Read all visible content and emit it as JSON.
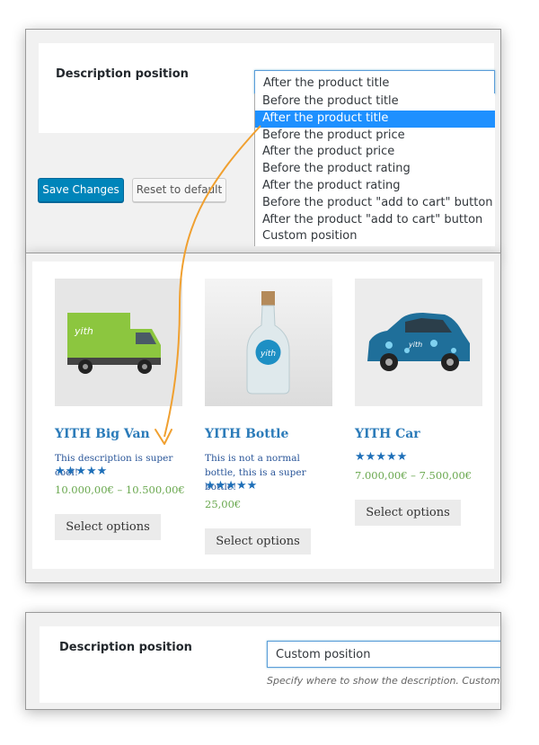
{
  "top_panel": {
    "label": "Description position",
    "select_value": "After the product title",
    "options": [
      "Before the product title",
      "After the product title",
      "Before the product price",
      "After the product price",
      "Before the product rating",
      "After the product rating",
      "Before the product \"add to cart\" button",
      "After the product \"add to cart\" button",
      "Custom position"
    ],
    "selected_index": 1,
    "save_label": "Save Changes",
    "reset_label": "Reset to default"
  },
  "products": [
    {
      "title": "YITH Big Van",
      "description": "This description is super cool!",
      "rating_stars": "★★★★★",
      "rating": 5,
      "price": "10.000,00€ – 10.500,00€",
      "button": "Select options",
      "image_icon": "green-delivery-van-image"
    },
    {
      "title": "YITH Bottle",
      "description": "This is not a normal bottle, this is a super bottle!",
      "rating_stars": "★★★★★",
      "rating": 5,
      "price": "25,00€",
      "button": "Select options",
      "image_icon": "glass-bottle-image"
    },
    {
      "title": "YITH Car",
      "description": "",
      "rating_stars": "★★★★★",
      "rating": 5,
      "price": "7.000,00€ – 7.500,00€",
      "button": "Select options",
      "image_icon": "blue-patterned-car-image"
    }
  ],
  "bottom_panel": {
    "label": "Description position",
    "select_value": "Custom position",
    "help": "Specify where to show the description. Custom position"
  },
  "colors": {
    "primary_button": "#0085ba",
    "link_blue": "#2b7bb9",
    "price_green": "#6aa84f",
    "arrow_orange": "#f0a030",
    "dropdown_highlight": "#1e90ff"
  }
}
